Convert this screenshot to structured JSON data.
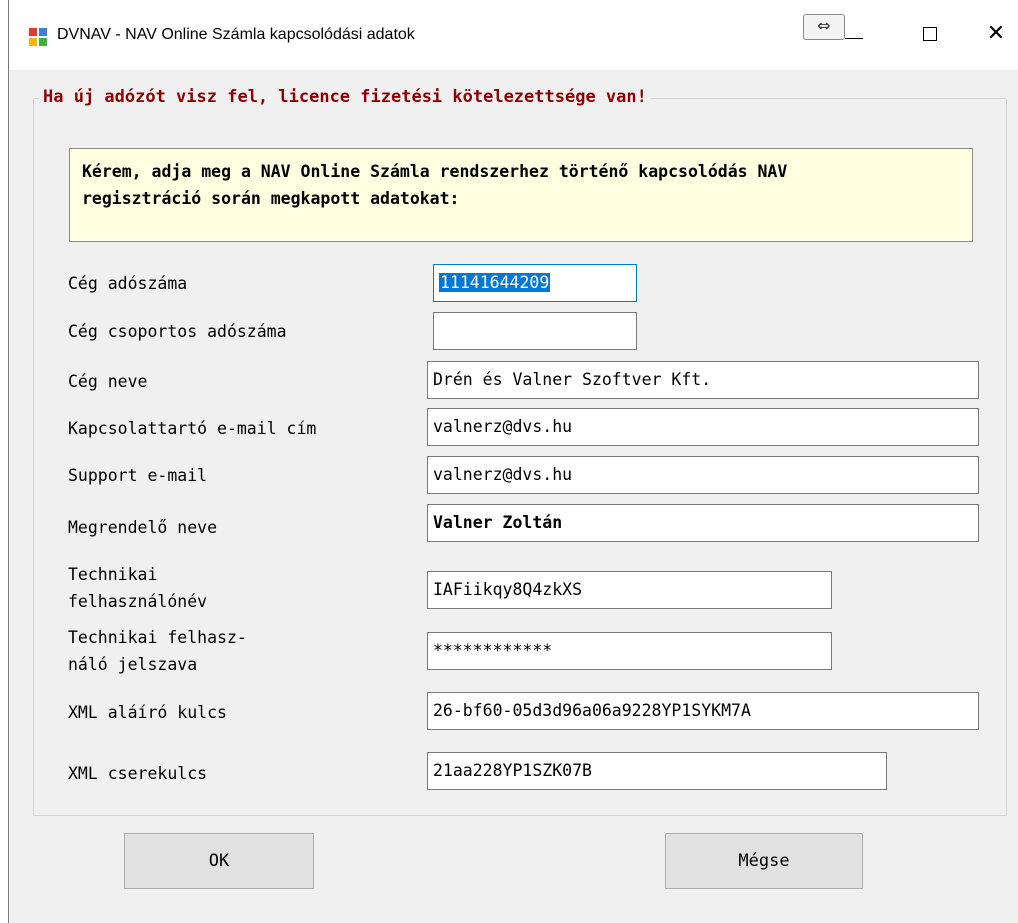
{
  "window": {
    "title": "DVNAV -  NAV Online Számla kapcsolódási adatok",
    "icon_colors": [
      "#e03c31",
      "#3c7fd9",
      "#f2b705",
      "#3cb043"
    ],
    "resize_glyph": "⇔",
    "close_glyph": "✕"
  },
  "group": {
    "legend": "Ha új adózót visz fel, licence fizetési kötelezettsége van!",
    "legend_color": "#8b0000"
  },
  "info": {
    "line1": "Kérem, adja meg a NAV Online Számla rendszerhez történő kapcsolódás NAV",
    "line2": "regisztráció során megkapott adatokat:",
    "background": "#ffffe1"
  },
  "fields": {
    "tax_number": {
      "label": "Cég adószáma",
      "value": "11141644209"
    },
    "group_tax_number": {
      "label": "Cég csoportos adószáma",
      "value": ""
    },
    "company_name": {
      "label": "Cég neve",
      "value": "Drén és Valner Szoftver Kft."
    },
    "contact_email": {
      "label": "Kapcsolattartó e-mail cím",
      "value": "valnerz@dvs.hu"
    },
    "support_email": {
      "label": "Support e-mail",
      "value": "valnerz@dvs.hu"
    },
    "customer_name": {
      "label": "Megrendelő neve",
      "value": "Valner Zoltán"
    },
    "tech_user": {
      "label_line1": "Technikai",
      "label_line2": "felhasználónév",
      "value": "IAFiikqy8Q4zkXS"
    },
    "tech_password": {
      "label_line1": "Technikai felhasz-",
      "label_line2": "náló jelszava",
      "value": "************"
    },
    "xml_sign_key": {
      "label": "XML aláíró kulcs",
      "value": "26-bf60-05d3d96a06a9228YP1SYKM7A"
    },
    "xml_exchange_key": {
      "label": "XML cserekulcs",
      "value": "21aa228YP1SZK07B"
    }
  },
  "buttons": {
    "ok": "OK",
    "cancel": "Mégse"
  },
  "colors": {
    "selection": "#0078d7",
    "dialog_bg": "#f0f0f0"
  }
}
